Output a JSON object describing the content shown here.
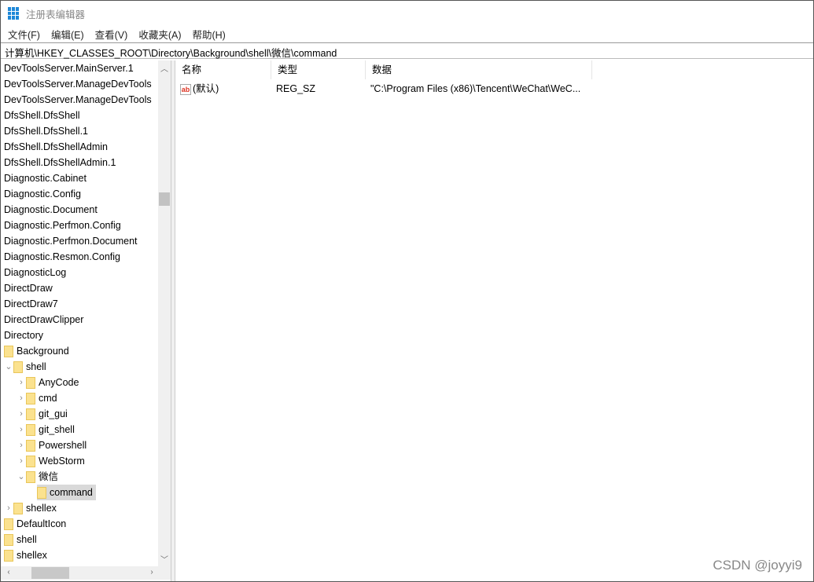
{
  "window": {
    "title": "注册表编辑器"
  },
  "menu": [
    "文件(F)",
    "编辑(E)",
    "查看(V)",
    "收藏夹(A)",
    "帮助(H)"
  ],
  "address": "计算机\\HKEY_CLASSES_ROOT\\Directory\\Background\\shell\\微信\\command",
  "tree": [
    {
      "label": "DevToolsServer.MainServer.1",
      "level": 0,
      "folder": false,
      "chev": ""
    },
    {
      "label": "DevToolsServer.ManageDevTools",
      "level": 0,
      "folder": false,
      "chev": ""
    },
    {
      "label": "DevToolsServer.ManageDevTools",
      "level": 0,
      "folder": false,
      "chev": ""
    },
    {
      "label": "DfsShell.DfsShell",
      "level": 0,
      "folder": false,
      "chev": ""
    },
    {
      "label": "DfsShell.DfsShell.1",
      "level": 0,
      "folder": false,
      "chev": ""
    },
    {
      "label": "DfsShell.DfsShellAdmin",
      "level": 0,
      "folder": false,
      "chev": ""
    },
    {
      "label": "DfsShell.DfsShellAdmin.1",
      "level": 0,
      "folder": false,
      "chev": ""
    },
    {
      "label": "Diagnostic.Cabinet",
      "level": 0,
      "folder": false,
      "chev": ""
    },
    {
      "label": "Diagnostic.Config",
      "level": 0,
      "folder": false,
      "chev": ""
    },
    {
      "label": "Diagnostic.Document",
      "level": 0,
      "folder": false,
      "chev": ""
    },
    {
      "label": "Diagnostic.Perfmon.Config",
      "level": 0,
      "folder": false,
      "chev": ""
    },
    {
      "label": "Diagnostic.Perfmon.Document",
      "level": 0,
      "folder": false,
      "chev": ""
    },
    {
      "label": "Diagnostic.Resmon.Config",
      "level": 0,
      "folder": false,
      "chev": ""
    },
    {
      "label": "DiagnosticLog",
      "level": 0,
      "folder": false,
      "chev": ""
    },
    {
      "label": "DirectDraw",
      "level": 0,
      "folder": false,
      "chev": ""
    },
    {
      "label": "DirectDraw7",
      "level": 0,
      "folder": false,
      "chev": ""
    },
    {
      "label": "DirectDrawClipper",
      "level": 0,
      "folder": false,
      "chev": ""
    },
    {
      "label": "Directory",
      "level": 0,
      "folder": false,
      "chev": ""
    },
    {
      "label": "Background",
      "level": 1,
      "folder": true,
      "chev": ""
    },
    {
      "label": "shell",
      "level": 2,
      "folder": true,
      "chev": "⌄"
    },
    {
      "label": "AnyCode",
      "level": 3,
      "folder": true,
      "chev": "›"
    },
    {
      "label": "cmd",
      "level": 3,
      "folder": true,
      "chev": "›"
    },
    {
      "label": "git_gui",
      "level": 3,
      "folder": true,
      "chev": "›"
    },
    {
      "label": "git_shell",
      "level": 3,
      "folder": true,
      "chev": "›"
    },
    {
      "label": "Powershell",
      "level": 3,
      "folder": true,
      "chev": "›"
    },
    {
      "label": "WebStorm",
      "level": 3,
      "folder": true,
      "chev": "›"
    },
    {
      "label": "微信",
      "level": 3,
      "folder": true,
      "chev": "⌄"
    },
    {
      "label": "command",
      "level": 4,
      "folder": true,
      "chev": "",
      "selected": true
    },
    {
      "label": "shellex",
      "level": 2,
      "folder": true,
      "chev": "›"
    },
    {
      "label": "DefaultIcon",
      "level": 1,
      "folder": true,
      "chev": ""
    },
    {
      "label": "shell",
      "level": 1,
      "folder": true,
      "chev": ""
    },
    {
      "label": "shellex",
      "level": 1,
      "folder": true,
      "chev": ""
    }
  ],
  "list": {
    "headers": [
      "名称",
      "类型",
      "数据"
    ],
    "rows": [
      {
        "name": "(默认)",
        "type": "REG_SZ",
        "data": "\"C:\\Program Files (x86)\\Tencent\\WeChat\\WeC..."
      }
    ]
  },
  "watermark": "CSDN @joyyi9"
}
